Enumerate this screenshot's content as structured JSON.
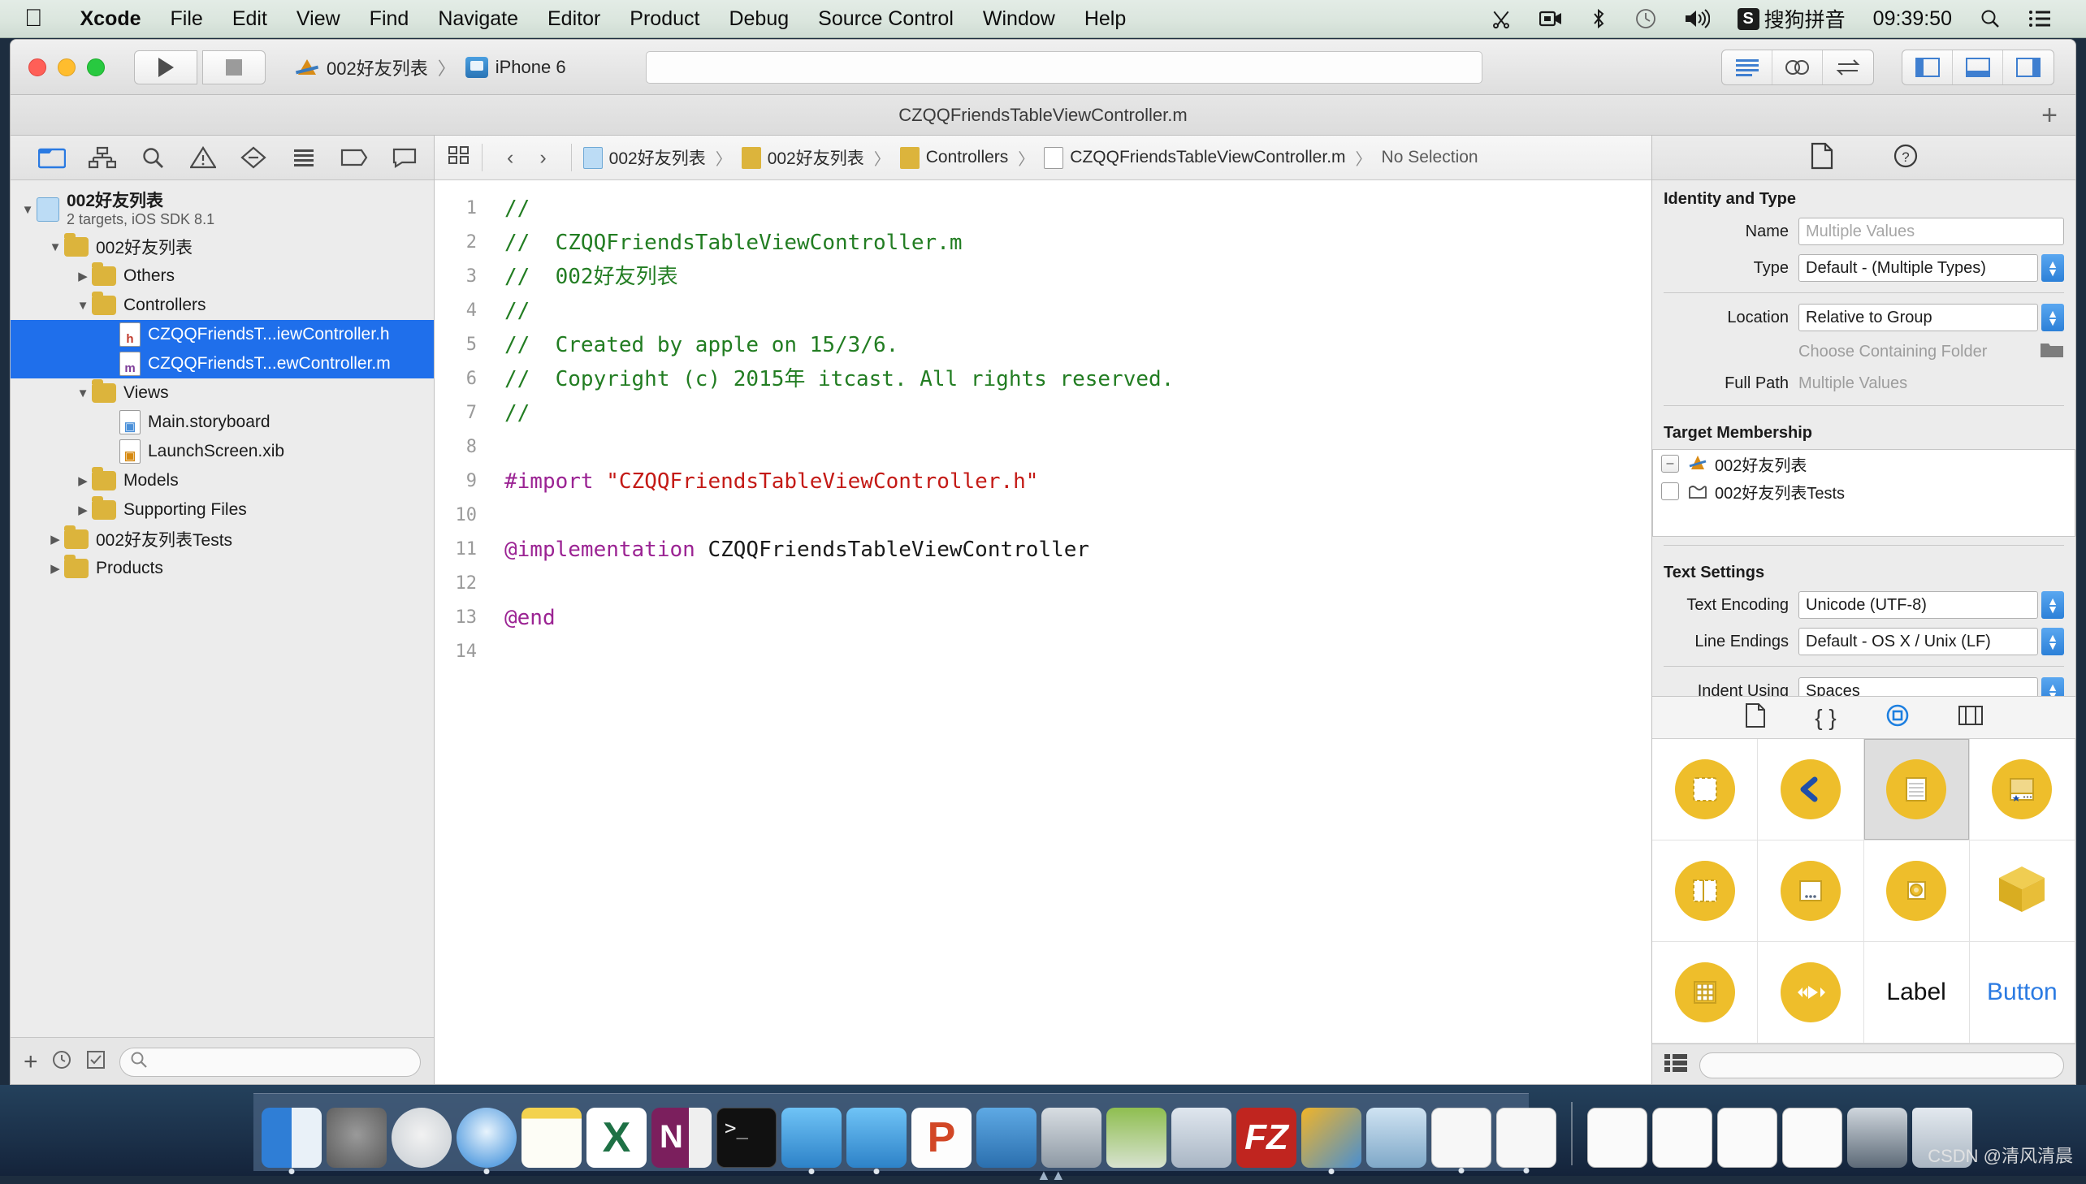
{
  "menubar": {
    "apple_icon": "apple-logo-icon",
    "items": [
      "Xcode",
      "File",
      "Edit",
      "View",
      "Find",
      "Navigate",
      "Editor",
      "Product",
      "Debug",
      "Source Control",
      "Window",
      "Help"
    ],
    "status": {
      "icons": [
        "scissors-icon",
        "screen-record-icon",
        "bluetooth-icon",
        "clock-icon",
        "volume-icon"
      ],
      "input_method_badge": "S",
      "input_method": "搜狗拼音",
      "clock": "09:39:50",
      "spotlight_icon": "search-icon",
      "notification_icon": "list-icon"
    }
  },
  "toolbar": {
    "run_button": "run-button",
    "stop_button": "stop-button",
    "scheme_name": "002好友列表",
    "scheme_separator": "〉",
    "destination": "iPhone 6",
    "search_placeholder": "",
    "right_buttons": [
      "standard-editor-icon",
      "assistant-editor-icon",
      "version-editor-icon",
      "hide-navigator-icon",
      "hide-debug-icon",
      "hide-utilities-icon"
    ]
  },
  "tabstrip": {
    "title": "CZQQFriendsTableViewController.m",
    "add_tab_label": "+"
  },
  "navigator": {
    "tabs": [
      "project-navigator-icon",
      "symbol-navigator-icon",
      "find-navigator-icon",
      "issue-navigator-icon",
      "test-navigator-icon",
      "debug-navigator-icon",
      "breakpoint-navigator-icon",
      "report-navigator-icon"
    ],
    "selected_tab": 0,
    "tree": [
      {
        "depth": 0,
        "twisty": "down",
        "icon": "project-icon",
        "label": "002好友列表",
        "sublabel": "2 targets, iOS SDK 8.1",
        "selected": false
      },
      {
        "depth": 1,
        "twisty": "down",
        "icon": "folder-icon",
        "label": "002好友列表",
        "sublabel": "",
        "selected": false
      },
      {
        "depth": 2,
        "twisty": "right",
        "icon": "folder-icon",
        "label": "Others",
        "sublabel": "",
        "selected": false
      },
      {
        "depth": 2,
        "twisty": "down",
        "icon": "folder-icon",
        "label": "Controllers",
        "sublabel": "",
        "selected": false
      },
      {
        "depth": 3,
        "twisty": "none",
        "icon": "h-file-icon",
        "label": "CZQQFriendsT...iewController.h",
        "sublabel": "",
        "selected": true
      },
      {
        "depth": 3,
        "twisty": "none",
        "icon": "m-file-icon",
        "label": "CZQQFriendsT...ewController.m",
        "sublabel": "",
        "selected": true
      },
      {
        "depth": 2,
        "twisty": "down",
        "icon": "folder-icon",
        "label": "Views",
        "sublabel": "",
        "selected": false
      },
      {
        "depth": 3,
        "twisty": "none",
        "icon": "storyboard-icon",
        "label": "Main.storyboard",
        "sublabel": "",
        "selected": false
      },
      {
        "depth": 3,
        "twisty": "none",
        "icon": "xib-icon",
        "label": "LaunchScreen.xib",
        "sublabel": "",
        "selected": false
      },
      {
        "depth": 2,
        "twisty": "right",
        "icon": "folder-icon",
        "label": "Models",
        "sublabel": "",
        "selected": false
      },
      {
        "depth": 2,
        "twisty": "right",
        "icon": "folder-icon",
        "label": "Supporting Files",
        "sublabel": "",
        "selected": false
      },
      {
        "depth": 1,
        "twisty": "right",
        "icon": "folder-icon",
        "label": "002好友列表Tests",
        "sublabel": "",
        "selected": false
      },
      {
        "depth": 1,
        "twisty": "right",
        "icon": "folder-icon",
        "label": "Products",
        "sublabel": "",
        "selected": false
      }
    ],
    "footer": {
      "add_label": "+",
      "recent_icon": "clock-icon",
      "source-control-icon": "source-control-icon",
      "filter_placeholder": ""
    }
  },
  "editor": {
    "jumpbar": {
      "related_items_icon": "related-items-icon",
      "back_arrow": "‹",
      "forward_arrow": "›",
      "crumbs": [
        "002好友列表",
        "002好友列表",
        "Controllers",
        "CZQQFriendsTableViewController.m",
        "No Selection"
      ],
      "separator": "〉"
    },
    "line_numbers": [
      1,
      2,
      3,
      4,
      5,
      6,
      7,
      8,
      9,
      10,
      11,
      12,
      13,
      14
    ],
    "lines": [
      {
        "n": 1,
        "segments": [
          {
            "t": "//",
            "c": "comment"
          }
        ]
      },
      {
        "n": 2,
        "segments": [
          {
            "t": "//  CZQQFriendsTableViewController.m",
            "c": "comment"
          }
        ]
      },
      {
        "n": 3,
        "segments": [
          {
            "t": "//  002好友列表",
            "c": "comment"
          }
        ]
      },
      {
        "n": 4,
        "segments": [
          {
            "t": "//",
            "c": "comment"
          }
        ]
      },
      {
        "n": 5,
        "segments": [
          {
            "t": "//  Created by apple on 15/3/6.",
            "c": "comment"
          }
        ]
      },
      {
        "n": 6,
        "segments": [
          {
            "t": "//  Copyright (c) 2015年 itcast. All rights reserved.",
            "c": "comment"
          }
        ]
      },
      {
        "n": 7,
        "segments": [
          {
            "t": "//",
            "c": "comment"
          }
        ]
      },
      {
        "n": 8,
        "segments": []
      },
      {
        "n": 9,
        "segments": [
          {
            "t": "#import ",
            "c": "pre"
          },
          {
            "t": "\"CZQQFriendsTableViewController.h\"",
            "c": "str"
          }
        ]
      },
      {
        "n": 10,
        "segments": []
      },
      {
        "n": 11,
        "segments": [
          {
            "t": "@implementation",
            "c": "kw"
          },
          {
            "t": " CZQQFriendsTableViewController",
            "c": "id"
          }
        ]
      },
      {
        "n": 12,
        "segments": []
      },
      {
        "n": 13,
        "segments": [
          {
            "t": "@end",
            "c": "kw"
          }
        ]
      },
      {
        "n": 14,
        "segments": []
      }
    ]
  },
  "inspector": {
    "tabs": [
      "file-inspector-icon",
      "quick-help-icon"
    ],
    "identity_and_type": {
      "title": "Identity and Type",
      "name_label": "Name",
      "name_placeholder": "Multiple Values",
      "name_value": "",
      "type_label": "Type",
      "type_value": "Default - (Multiple Types)",
      "location_label": "Location",
      "location_value": "Relative to Group",
      "choose_folder_label": "Choose Containing Folder",
      "folder_icon": "folder-icon",
      "full_path_label": "Full Path",
      "full_path_value": "Multiple Values"
    },
    "target_membership": {
      "title": "Target Membership",
      "rows": [
        {
          "checkbox": "mixed",
          "icon": "app-target-icon",
          "label": "002好友列表"
        },
        {
          "checkbox": "off",
          "icon": "test-target-icon",
          "label": "002好友列表Tests"
        }
      ]
    },
    "text_settings": {
      "title": "Text Settings",
      "rows": [
        {
          "label": "Text Encoding",
          "value": "Unicode (UTF-8)"
        },
        {
          "label": "Line Endings",
          "value": "Default - OS X / Unix (LF)"
        },
        {
          "label": "Indent Using",
          "value": "Spaces"
        }
      ]
    },
    "library": {
      "tabs": [
        "file-template-library-icon",
        "code-snippet-library-icon",
        "object-library-icon",
        "media-library-icon"
      ],
      "selected_tab": 2,
      "items": [
        {
          "name": "view-controller",
          "kind": "circle",
          "glyph": "dashed-rect",
          "selected": false
        },
        {
          "name": "navigation-controller",
          "kind": "circle",
          "glyph": "back-chevron",
          "selected": false
        },
        {
          "name": "table-view-controller",
          "kind": "circle",
          "glyph": "lined-page",
          "selected": true
        },
        {
          "name": "tab-bar-controller",
          "kind": "circle",
          "glyph": "tabbar-panel",
          "selected": false
        },
        {
          "name": "split-view-controller",
          "kind": "circle",
          "glyph": "split-rect",
          "selected": false
        },
        {
          "name": "page-view-controller",
          "kind": "circle",
          "glyph": "dots-panel",
          "selected": false
        },
        {
          "name": "glkit-view-controller",
          "kind": "circle",
          "glyph": "target-square",
          "selected": false
        },
        {
          "name": "object",
          "kind": "cube",
          "glyph": "cube",
          "selected": false
        },
        {
          "name": "collection-view-controller",
          "kind": "circle",
          "glyph": "grid",
          "selected": false
        },
        {
          "name": "avkit-player-controller",
          "kind": "circle",
          "glyph": "media-transport",
          "selected": false
        },
        {
          "name": "label",
          "kind": "text",
          "glyph": "Label",
          "selected": false
        },
        {
          "name": "button",
          "kind": "text-blue",
          "glyph": "Button",
          "selected": false
        }
      ],
      "footer": {
        "layout_icon": "list-layout-icon",
        "search_placeholder": ""
      }
    }
  },
  "dock": {
    "left_items": [
      "finder",
      "system-preferences",
      "launchpad",
      "safari",
      "notes",
      "excel",
      "onenote",
      "terminal",
      "xcode-beta",
      "xcode-device",
      "powerpoint",
      "snipping-tool",
      "imovie",
      "folder-green",
      "zip"
    ],
    "right_items": [
      "doc-1",
      "doc-2",
      "doc-3",
      "doc-4",
      "screen-share",
      "trash"
    ]
  },
  "watermark": "CSDN @清风清晨"
}
